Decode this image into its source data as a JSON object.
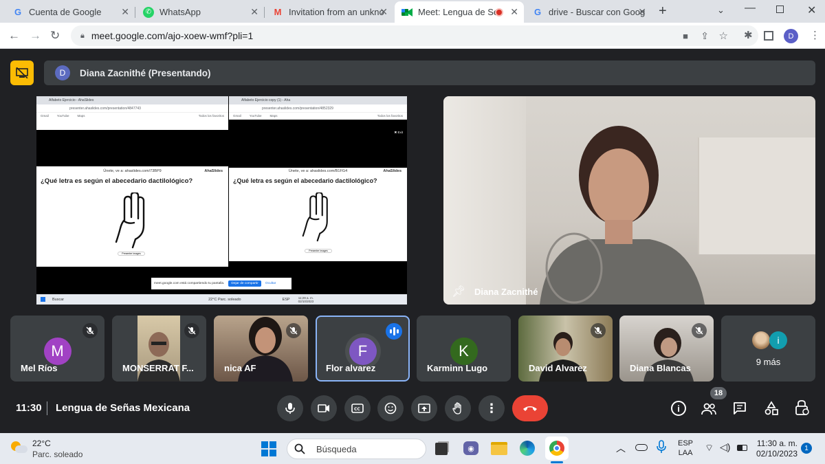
{
  "tabs": [
    {
      "title": "Cuenta de Google",
      "icon": "google-icon"
    },
    {
      "title": "WhatsApp",
      "icon": "whatsapp-icon"
    },
    {
      "title": "Invitation from an unkno",
      "icon": "gmail-icon"
    },
    {
      "title": "Meet: Lengua de Se",
      "icon": "meet-icon",
      "active": true
    },
    {
      "title": "drive - Buscar con Googl",
      "icon": "google-icon"
    }
  ],
  "address": "meet.google.com/ajo-xoew-wmf?pli=1",
  "presenter_banner": {
    "avatar": "D",
    "text": "Diana Zacnithé (Presentando)"
  },
  "shared_screen": {
    "left_tab": "Alfabeto Ejercicio - AhaSlides",
    "right_tab": "Alfabeto Ejercicio copy (1) - Aha",
    "left_url": "presenter.ahaslides.com/presentation/4847743",
    "right_url": "presenter.ahaslides.com/presentation/4852329",
    "bookmarks": [
      "Gmail",
      "YouTube",
      "Maps"
    ],
    "bookmarks_folder": "Todos los favoritos",
    "exit": "✖ Exit",
    "left_join": "Únete, ve a: ahaslides.com/73BP9",
    "right_join": "Únete, ve a: ahaslides.com/B1FG4",
    "brand": "AhaSlides",
    "question": "¿Qué letra es según el abecedario dactilológico?",
    "left_small_btn": "Presenter images",
    "right_small_btn": "Presenter images",
    "share_notice": "meet.google.com está compartiendo tu pantalla.",
    "stop_share": "Dejar de compartir",
    "hide": "Ocultar",
    "search": "Buscar",
    "weather": "22°C  Parc. soleado",
    "lang": "ESP",
    "time": "11:29 a. m.",
    "date": "02/10/2023"
  },
  "main_video": {
    "name": "Diana Zacnithé"
  },
  "participants": [
    {
      "name": "Mel Ríos",
      "initial": "M",
      "color": "#a142c4",
      "muted": true,
      "video": false
    },
    {
      "name": "MONSERRAT F...",
      "muted": true,
      "video": true
    },
    {
      "name": "nica AF",
      "muted": true,
      "video": true
    },
    {
      "name": "Flor alvarez",
      "initial": "F",
      "color": "#7e57c2",
      "speaking": true,
      "video": false
    },
    {
      "name": "Karminn Lugo",
      "initial": "K",
      "color": "#33691e",
      "video": false
    },
    {
      "name": "David Alvarez",
      "muted": true,
      "video": true
    },
    {
      "name": "Diana Blancas",
      "muted": true,
      "video": true
    }
  ],
  "more": {
    "text": "9 más",
    "initial": "i"
  },
  "bottom": {
    "time": "11:30",
    "meeting": "Lengua de Señas Mexicana",
    "people_count": "18"
  },
  "taskbar": {
    "temp": "22°C",
    "weather": "Parc. soleado",
    "search": "Búsqueda",
    "lang1": "ESP",
    "lang2": "LAA",
    "time": "11:30 a. m.",
    "date": "02/10/2023",
    "notif": "1"
  },
  "colors": {
    "end_call": "#ea4335",
    "accent": "#8ab4f8",
    "banner_icon": "#fbbc04"
  }
}
